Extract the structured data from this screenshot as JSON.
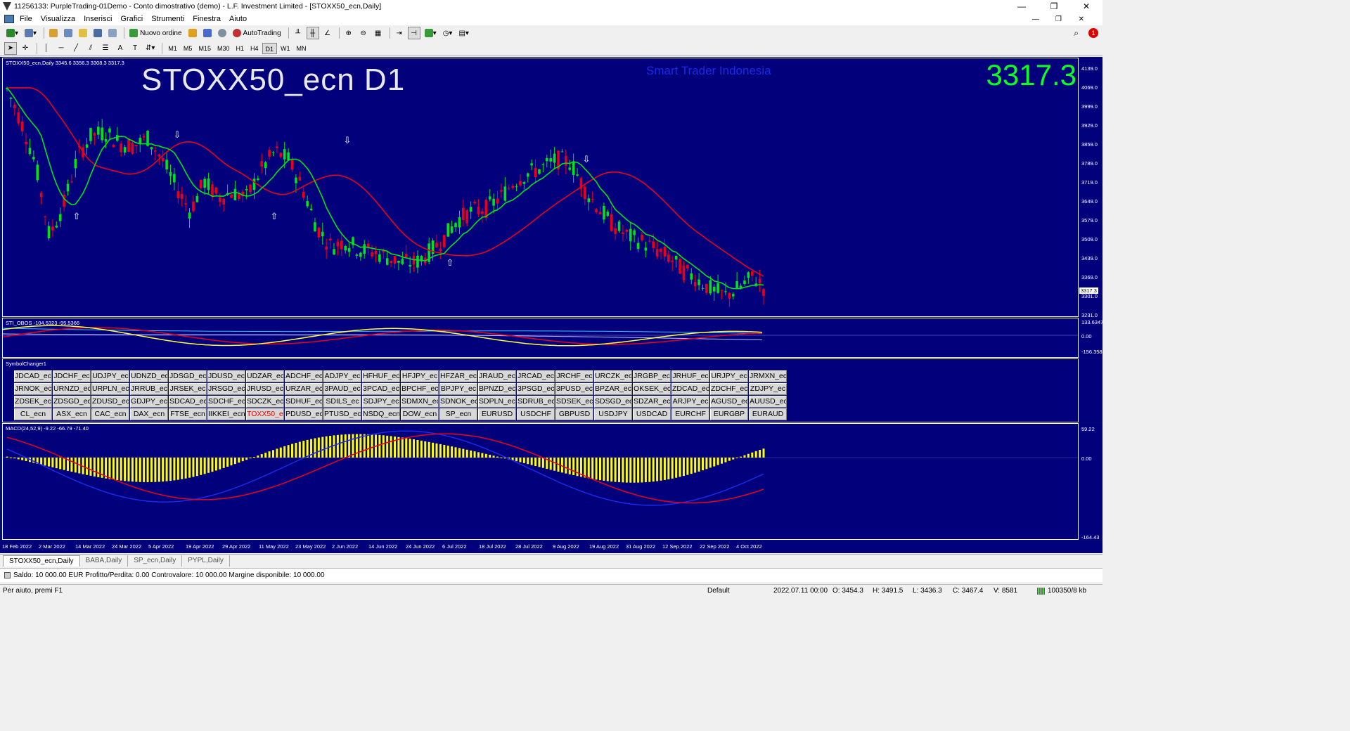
{
  "window": {
    "title": "11256133: PurpleTrading-01Demo - Conto dimostrativo (demo) - L.F. Investment Limited - [STOXX50_ecn,Daily]",
    "minimize": "—",
    "restore": "❐",
    "close": "✕"
  },
  "menu": [
    "File",
    "Visualizza",
    "Inserisci",
    "Grafici",
    "Strumenti",
    "Finestra",
    "Aiuto"
  ],
  "toolbar": {
    "new_order": "Nuovo ordine",
    "autotrading": "AutoTrading",
    "notif_count": "1"
  },
  "timeframes": [
    "M1",
    "M5",
    "M15",
    "M30",
    "H1",
    "H4",
    "D1",
    "W1",
    "MN"
  ],
  "active_timeframe": "D1",
  "main_chart": {
    "label": "STOXX50_ecn,Daily  3345.6 3356.3 3308.3 3317.3",
    "title": "STOXX50_ecn D1",
    "brand": "Smart Trader Indonesia",
    "price": "3317.3",
    "price_tag": "3317.3",
    "y_ticks": [
      "4139.0",
      "4069.0",
      "3999.0",
      "3929.0",
      "3859.0",
      "3789.0",
      "3719.0",
      "3649.0",
      "3579.0",
      "3509.0",
      "3439.0",
      "3369.0",
      "3301.0",
      "3231.0"
    ]
  },
  "obos": {
    "label": "STI_OBOS -104.5323 -95.5366",
    "y_ticks": [
      "133.6347",
      "0.00",
      "-156.358"
    ]
  },
  "symbol_changer": {
    "label": "SymbolChanger1",
    "rows": [
      [
        "JDCAD_ec",
        "JDCHF_ec",
        "UDJPY_ec",
        "UDNZD_ec",
        "JDSGD_ec",
        "JDUSD_ec",
        "UDZAR_ec",
        "ADCHF_ec",
        "ADJPY_ec",
        "HFHUF_ec",
        "HFJPY_ec",
        "HFZAR_ec",
        "JRAUD_ec",
        "JRCAD_ec",
        "JRCHF_ec",
        "URCZK_ec",
        "JRGBP_ec",
        "JRHUF_ec",
        "URJPY_ec",
        "JRMXN_ec"
      ],
      [
        "JRNOK_ec",
        "URNZD_ec",
        "URPLN_ec",
        "JRRUB_ec",
        "JRSEK_ec",
        "JRSGD_ec",
        "JRUSD_ec",
        "URZAR_ec",
        "3PAUD_ec",
        "3PCAD_ec",
        "BPCHF_ec",
        "BPJPY_ec",
        "BPNZD_ec",
        "3PSGD_ec",
        "3PUSD_ec",
        "BPZAR_ec",
        "OKSEK_ec",
        "ZDCAD_ec",
        "ZDCHF_ec",
        "ZDJPY_ec"
      ],
      [
        "ZDSEK_ec",
        "ZDSGD_ec",
        "ZDUSD_ec",
        "GDJPY_ec",
        "SDCAD_ec",
        "SDCHF_ec",
        "SDCZK_ec",
        "SDHUF_ec",
        "SDILS_ec",
        "SDJPY_ec",
        "SDMXN_ec",
        "SDNOK_ec",
        "SDPLN_ec",
        "SDRUB_ec",
        "SDSEK_ec",
        "SDSGD_ec",
        "SDZAR_ec",
        "ARJPY_ec",
        "AGUSD_ec",
        "AUUSD_ec"
      ],
      [
        "CL_ecn",
        "ASX_ecn",
        "CAC_ecn",
        "DAX_ecn",
        "FTSE_ecn",
        "IIKKEI_ecn",
        "TOXX50_ec",
        "PDUSD_ec",
        "PTUSD_ec",
        "NSDQ_ecn",
        "DOW_ecn",
        "SP_ecn",
        "EURUSD",
        "USDCHF",
        "GBPUSD",
        "USDJPY",
        "USDCAD",
        "EURCHF",
        "EURGBP",
        "EURAUD"
      ]
    ],
    "selected": "TOXX50_ec"
  },
  "macd": {
    "label": "MACD(24,52,9) -9.22 -66.79 -71.40",
    "y_ticks": [
      "59.22",
      "0.00",
      "-164.43"
    ]
  },
  "x_ticks": [
    "18 Feb 2022",
    "2 Mar 2022",
    "14 Mar 2022",
    "24 Mar 2022",
    "5 Apr 2022",
    "19 Apr 2022",
    "29 Apr 2022",
    "11 May 2022",
    "23 May 2022",
    "2 Jun 2022",
    "14 Jun 2022",
    "24 Jun 2022",
    "6 Jul 2022",
    "18 Jul 2022",
    "28 Jul 2022",
    "9 Aug 2022",
    "19 Aug 2022",
    "31 Aug 2022",
    "12 Sep 2022",
    "22 Sep 2022",
    "4 Oct 2022"
  ],
  "tabs": [
    "STOXX50_ecn,Daily",
    "BABA,Daily",
    "SP_ecn,Daily",
    "PYPL,Daily"
  ],
  "account": "Saldo: 10 000.00 EUR  Profitto/Perdita: 0.00  Controvalore: 10 000.00  Margine disponibile: 10 000.00",
  "status": {
    "help": "Per aiuto, premi F1",
    "profile": "Default",
    "datetime": "2022.07.11 00:00",
    "open": "O: 3454.3",
    "high": "H: 3491.5",
    "low": "L: 3436.3",
    "close": "C: 3467.4",
    "volume": "V: 8581",
    "traffic": "100350/8 kb"
  },
  "colors": {
    "bg": "#02007a",
    "bull": "#00e21a",
    "bear": "#e8001a",
    "ma_fast": "#00e21a",
    "ma_slow": "#e8001a",
    "hist": "#ffff00",
    "macd_line": "#1a2ae8",
    "signal_line": "#e8001a",
    "obos_yellow": "#ffff40",
    "obos_cyan": "#40c0ff"
  }
}
